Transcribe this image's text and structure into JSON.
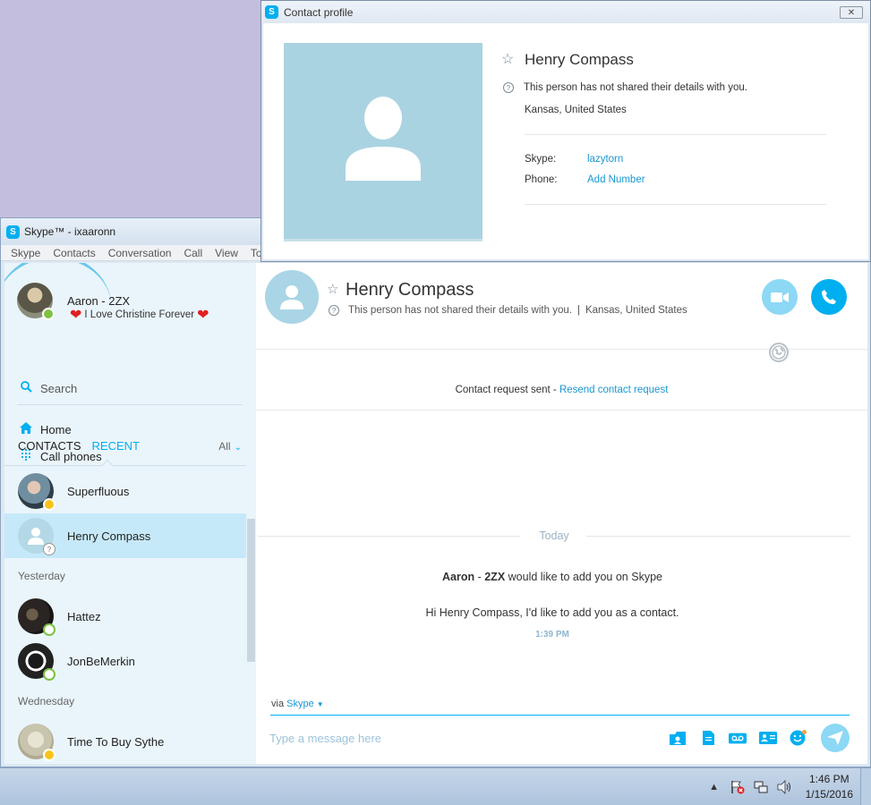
{
  "skype_window": {
    "title": "Skype™ - ixaaronn",
    "menu": [
      "Skype",
      "Contacts",
      "Conversation",
      "Call",
      "View",
      "Too"
    ]
  },
  "sidebar": {
    "me": {
      "name": "Aaron - 2ZX",
      "mood": "I Love Christine Forever"
    },
    "search_label": "Search",
    "nav": {
      "home": "Home",
      "call_phones": "Call phones"
    },
    "tabs": {
      "contacts": "CONTACTS",
      "recent": "RECENT",
      "filter": "All"
    },
    "recent": [
      {
        "name": "Superfluous",
        "status": "away"
      },
      {
        "name": "Henry Compass",
        "status": "unknown"
      }
    ],
    "sections": {
      "yesterday": "Yesterday",
      "wednesday": "Wednesday"
    },
    "yesterday": [
      {
        "name": "Hattez",
        "status": "offline"
      },
      {
        "name": "JonBeMerkin",
        "status": "offline"
      }
    ],
    "wednesday": [
      {
        "name": "Time To Buy Sythe",
        "status": "away"
      }
    ]
  },
  "conversation": {
    "contact_name": "Henry Compass",
    "details_note": "This person has not shared their details with you.",
    "separator": "|",
    "location": "Kansas, United States",
    "request_text": "Contact request sent - ",
    "resend_link": "Resend contact request",
    "today_label": "Today",
    "add_request": {
      "name_part1": "Aaron",
      "name_sep": " - ",
      "name_part2": "2ZX",
      "suffix": " would like to add you on Skype"
    },
    "add_message": "Hi Henry Compass, I'd like to add you as a contact.",
    "add_time": "1:39 PM",
    "via_label": "via",
    "via_service": "Skype",
    "input_placeholder": "Type a message here"
  },
  "profile_window": {
    "title": "Contact profile",
    "name": "Henry Compass",
    "note": "This person has not shared their details with you.",
    "location": "Kansas, United States",
    "skype_label": "Skype:",
    "skype_value": "lazytorn",
    "phone_label": "Phone:",
    "phone_value": "Add Number"
  },
  "taskbar": {
    "time": "1:46 PM",
    "date": "1/15/2016"
  },
  "colors": {
    "accent": "#00aff0",
    "link": "#1a98d1",
    "away": "#f8c41b",
    "online": "#7dc242",
    "photo_placeholder": "#aad3e2"
  }
}
